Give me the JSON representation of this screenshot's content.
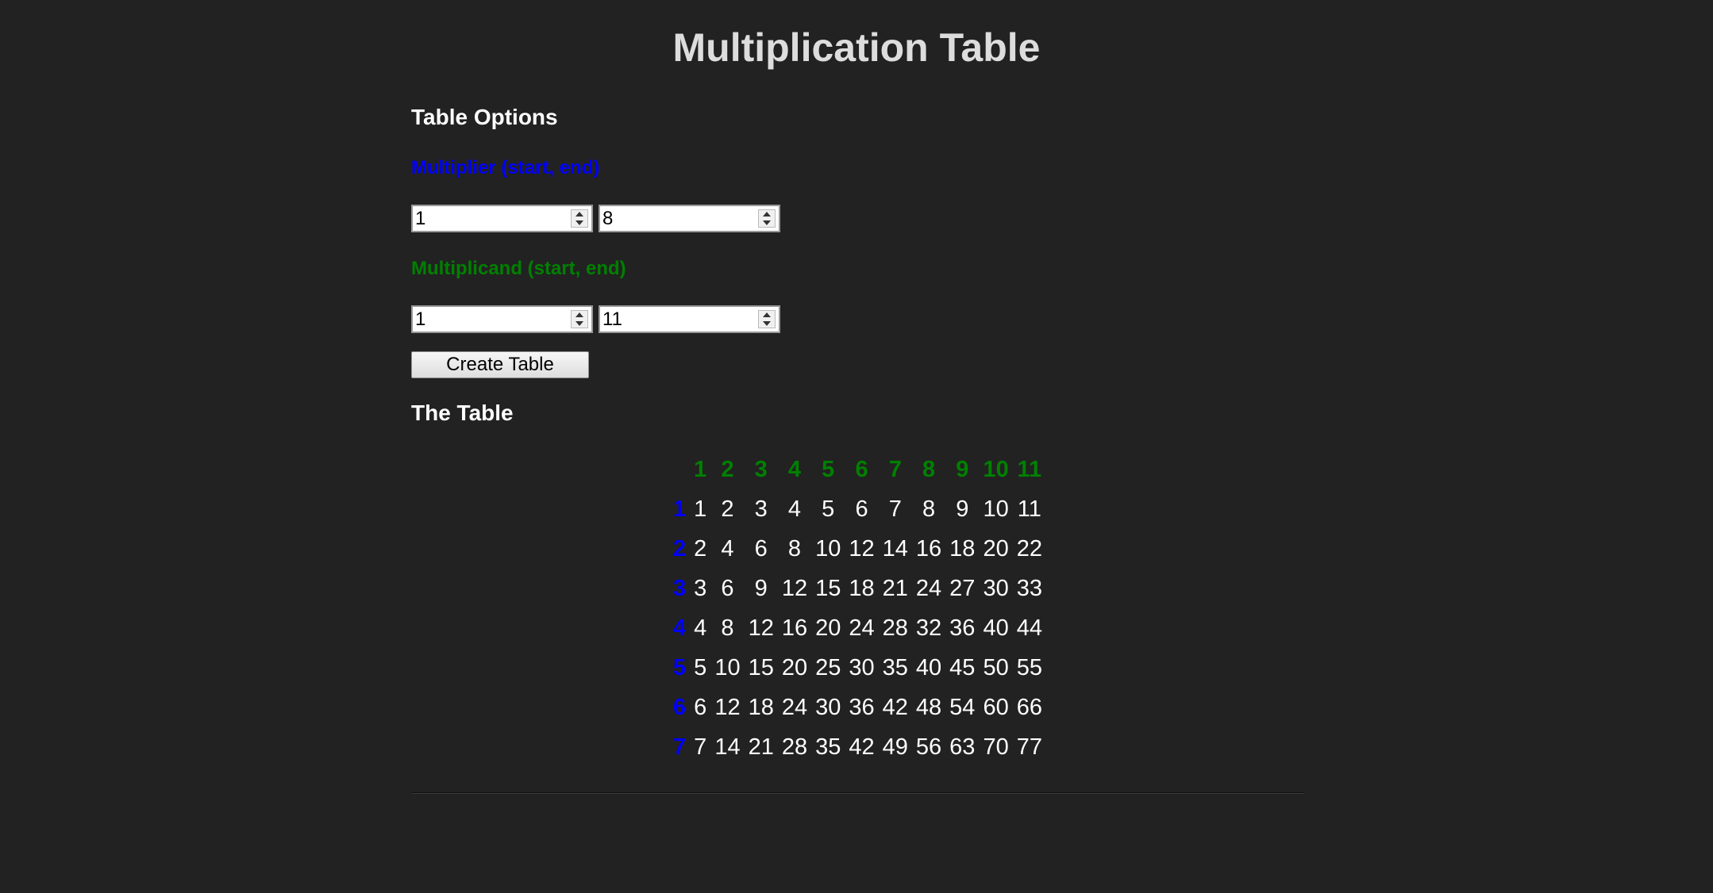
{
  "page": {
    "title": "Multiplication Table"
  },
  "options": {
    "heading": "Table Options",
    "multiplier": {
      "label": "Multiplier (start, end)",
      "start": "1",
      "end": "8"
    },
    "multiplicand": {
      "label": "Multiplicand (start, end)",
      "start": "1",
      "end": "11"
    },
    "create_button": "Create Table"
  },
  "table": {
    "heading": "The Table",
    "column_headers": [
      "1",
      "2",
      "3",
      "4",
      "5",
      "6",
      "7",
      "8",
      "9",
      "10",
      "11"
    ],
    "row_headers": [
      "1",
      "2",
      "3",
      "4",
      "5",
      "6",
      "7"
    ],
    "rows": [
      [
        "1",
        "2",
        "3",
        "4",
        "5",
        "6",
        "7",
        "8",
        "9",
        "10",
        "11"
      ],
      [
        "2",
        "4",
        "6",
        "8",
        "10",
        "12",
        "14",
        "16",
        "18",
        "20",
        "22"
      ],
      [
        "3",
        "6",
        "9",
        "12",
        "15",
        "18",
        "21",
        "24",
        "27",
        "30",
        "33"
      ],
      [
        "4",
        "8",
        "12",
        "16",
        "20",
        "24",
        "28",
        "32",
        "36",
        "40",
        "44"
      ],
      [
        "5",
        "10",
        "15",
        "20",
        "25",
        "30",
        "35",
        "40",
        "45",
        "50",
        "55"
      ],
      [
        "6",
        "12",
        "18",
        "24",
        "30",
        "36",
        "42",
        "48",
        "54",
        "60",
        "66"
      ],
      [
        "7",
        "14",
        "21",
        "28",
        "35",
        "42",
        "49",
        "56",
        "63",
        "70",
        "77"
      ]
    ]
  },
  "colors": {
    "background": "#222222",
    "multiplier_label": "#0000ff",
    "multiplicand_label": "#008000",
    "column_header": "#008000",
    "row_header": "#0000ff",
    "cell_text": "#ffffff"
  }
}
